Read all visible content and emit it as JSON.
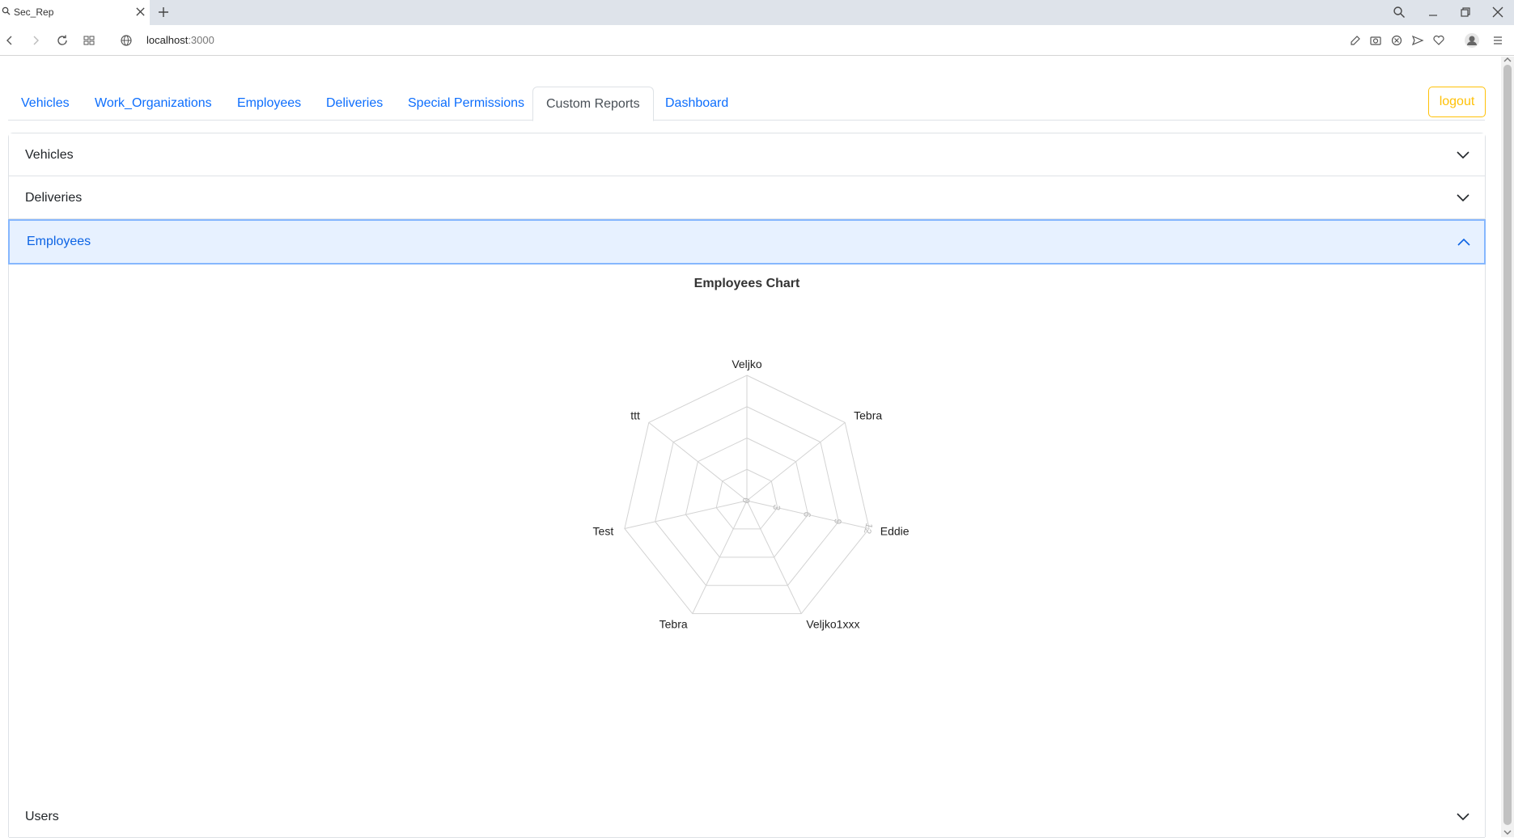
{
  "browser": {
    "tab_title": "Sec_Rep",
    "url_host": "localhost",
    "url_port": ":3000"
  },
  "nav": {
    "tabs": [
      "Vehicles",
      "Work_Organizations",
      "Employees",
      "Deliveries",
      "Special Permissions",
      "Custom Reports",
      "Dashboard"
    ],
    "active": "Custom Reports",
    "logout_label": "logout"
  },
  "accordion": {
    "sections": [
      {
        "label": "Vehicles",
        "expanded": false
      },
      {
        "label": "Deliveries",
        "expanded": false
      },
      {
        "label": "Employees",
        "expanded": true
      },
      {
        "label": "Users",
        "expanded": false
      }
    ]
  },
  "colors": {
    "link": "#0d6efd",
    "logout": "#ffc107",
    "accordion_active_bg": "#e7f1ff",
    "grid": "#d3d3d3"
  },
  "chart_data": {
    "type": "radar",
    "title": "Employees Chart",
    "categories": [
      "Veljko",
      "Tebra",
      "Eddie",
      "Veljko1xxx",
      "Tebra",
      "Test",
      "ttt"
    ],
    "series": [
      {
        "values": [
          0,
          0,
          0,
          0,
          0,
          0,
          0
        ]
      }
    ],
    "r_ticks": [
      0,
      3,
      6,
      9,
      12
    ],
    "r_range": [
      0,
      12
    ],
    "grid": true,
    "legend": false
  }
}
